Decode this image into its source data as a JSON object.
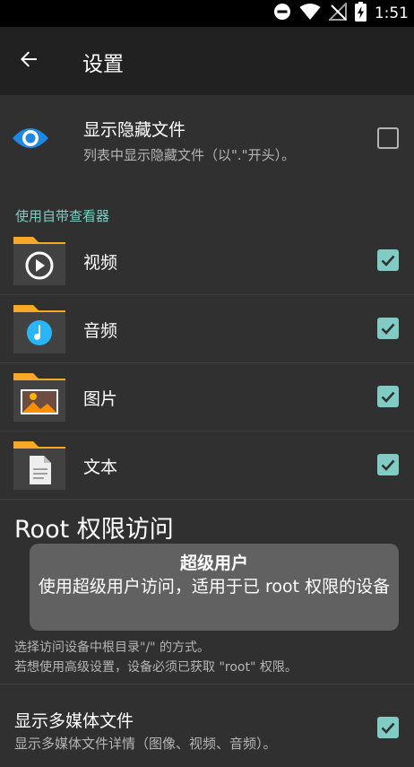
{
  "status_bar": {
    "time": "1:51",
    "icons": [
      "do-not-disturb-icon",
      "wifi-icon",
      "no-signal-icon",
      "battery-charging-icon"
    ]
  },
  "app_bar": {
    "title": "设置",
    "back_icon": "arrow-back-icon"
  },
  "show_hidden": {
    "title": "显示隐藏文件",
    "summary": "列表中显示隐藏文件（以\".\"开头）。",
    "icon": "eye-icon",
    "checked": false
  },
  "viewer_section": {
    "category": "使用自带查看器",
    "items": [
      {
        "label": "视频",
        "icon": "video-folder-icon",
        "checked": true
      },
      {
        "label": "音频",
        "icon": "audio-folder-icon",
        "checked": true
      },
      {
        "label": "图片",
        "icon": "image-folder-icon",
        "checked": true
      },
      {
        "label": "文本",
        "icon": "text-folder-icon",
        "checked": true
      }
    ]
  },
  "root_access": {
    "title": "Root 权限访问",
    "tooltip_title": "超级用户",
    "tooltip_body": "使用超级用户访问，适用于已 root 权限的设备",
    "desc_line1": "选择访问设备中根目录\"/\" 的方式。",
    "desc_line2": "若想使用高级设置，设备必须已获取 \"root\" 权限。"
  },
  "show_media": {
    "title": "显示多媒体文件",
    "summary": "显示多媒体文件详情（图像、视频、音频）。",
    "checked": true
  },
  "colors": {
    "accent": "#80cbc4",
    "folder": "#f9a825",
    "background": "#303030",
    "app_bar": "#212121",
    "tooltip": "#616161"
  }
}
